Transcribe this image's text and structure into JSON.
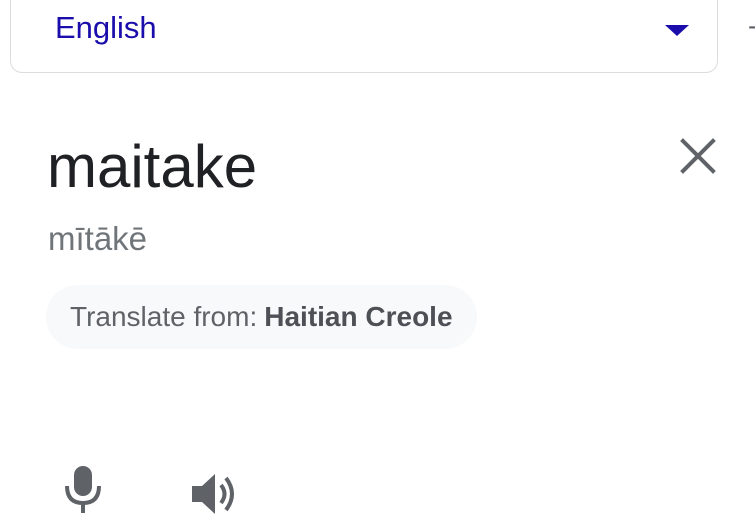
{
  "language_select": {
    "selected": "English",
    "arrow_icon": "dropdown-arrow-icon",
    "accent_color": "#1a0dab"
  },
  "entry": {
    "word": "maitake",
    "pronunciation": "mītākē"
  },
  "translate_chip": {
    "prefix": "Translate from:",
    "language": "Haitian Creole"
  },
  "icons": {
    "close": "close-icon",
    "microphone": "microphone-icon",
    "speaker": "speaker-icon"
  }
}
